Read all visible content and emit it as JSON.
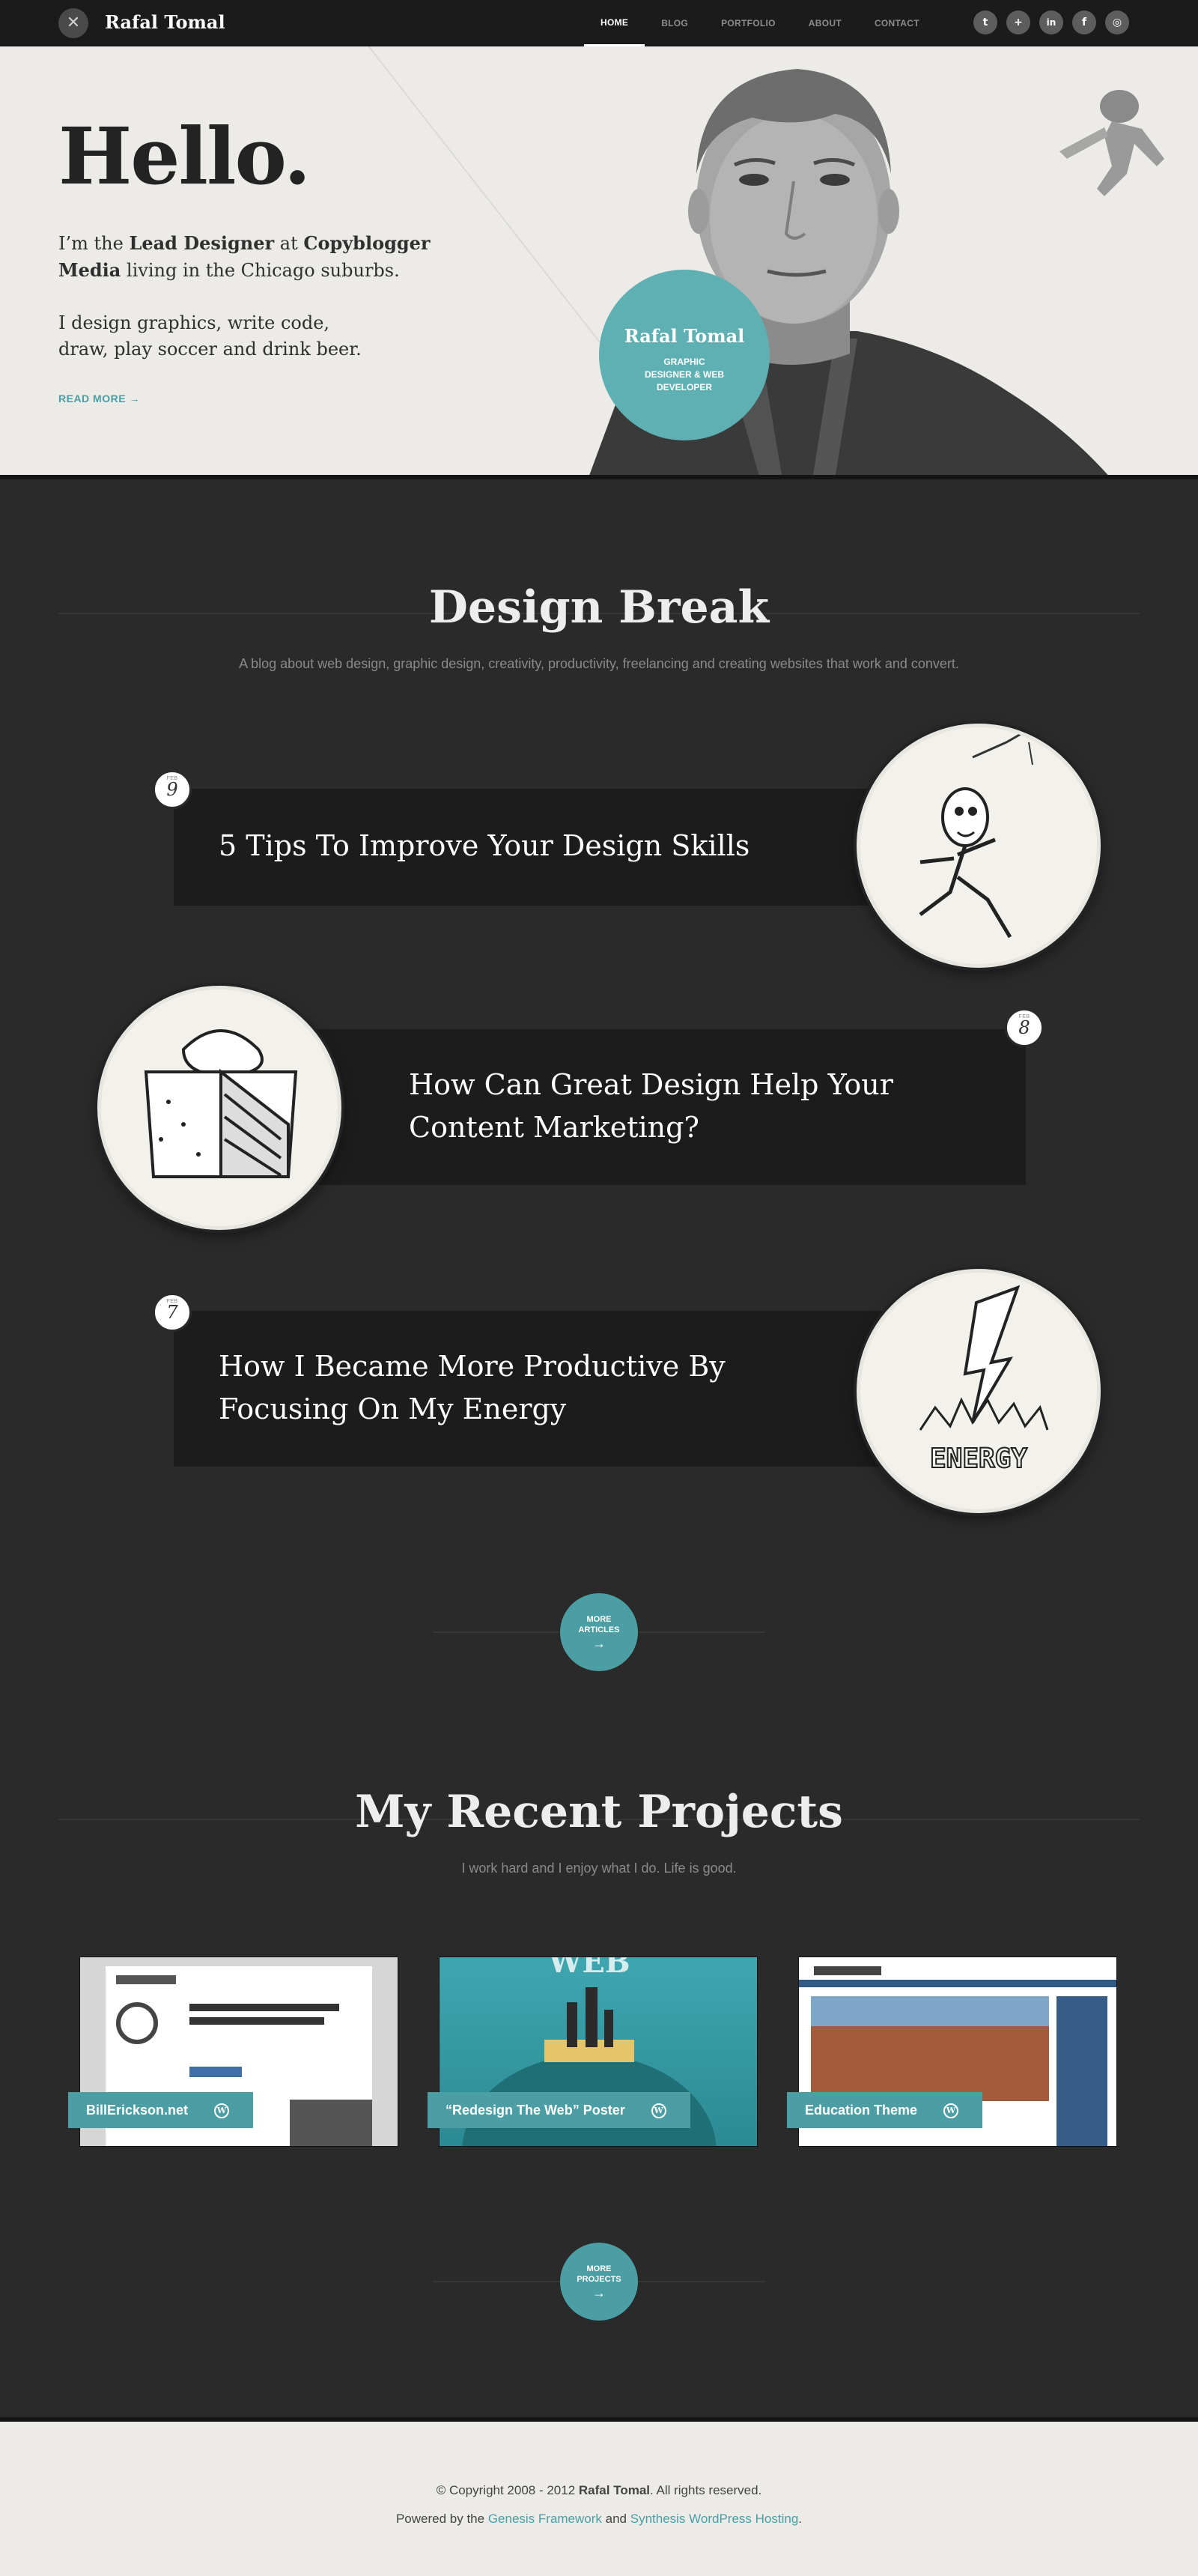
{
  "site": {
    "brand": "Rafal Tomal"
  },
  "nav": [
    {
      "label": "HOME",
      "active": true
    },
    {
      "label": "BLOG"
    },
    {
      "label": "PORTFOLIO"
    },
    {
      "label": "ABOUT"
    },
    {
      "label": "CONTACT"
    }
  ],
  "social": [
    {
      "name": "twitter-icon",
      "glyph": "t"
    },
    {
      "name": "google-plus-icon",
      "glyph": "+"
    },
    {
      "name": "linkedin-icon",
      "glyph": "in"
    },
    {
      "name": "facebook-icon",
      "glyph": "f"
    },
    {
      "name": "dribbble-icon",
      "glyph": "◎"
    }
  ],
  "hero": {
    "heading": "Hello.",
    "intro_pre": "I’m the ",
    "intro_role": "Lead Designer",
    "intro_mid": " at ",
    "intro_company": "Copyblogger Media",
    "intro_post": " living in the Chicago suburbs.",
    "intro2": "I design graphics, write code, draw, play soccer and drink beer.",
    "read_more": "READ MORE →",
    "badge_name": "Rafal Tomal",
    "badge_title": "GRAPHIC DESIGNER & WEB DEVELOPER"
  },
  "blog": {
    "title": "Design Break",
    "subtitle": "A blog about web design, graphic design, creativity, productivity, freelancing and creating websites that work and convert.",
    "articles": [
      {
        "title": "5 Tips To Improve Your Design Skills",
        "month": "FEB",
        "day": "9",
        "illustration": "running-man-illustration"
      },
      {
        "title": "How Can Great Design Help Your Content Marketing?",
        "month": "FEB",
        "day": "8",
        "illustration": "cake-illustration"
      },
      {
        "title": "How I Became More Productive By Focusing On My Energy",
        "month": "FEB",
        "day": "7",
        "illustration": "energy-illustration",
        "illustration_text": "ENERGY"
      }
    ],
    "more_label": "MORE ARTICLES",
    "more_arrow": "→"
  },
  "projects": {
    "title": "My Recent Projects",
    "subtitle": "I work hard and I enjoy what I do. Life is good.",
    "items": [
      {
        "caption": "BillErickson.net"
      },
      {
        "caption": "“Redesign The Web” Poster"
      },
      {
        "caption": "Education Theme"
      }
    ],
    "more_label": "MORE PROJECTS",
    "more_arrow": "→",
    "wp_glyph": "W"
  },
  "footer": {
    "copy_pre": "© Copyright 2008 - 2012 ",
    "copy_name": "Rafal Tomal",
    "copy_post": ". All rights reserved.",
    "powered_pre": "Powered by the ",
    "framework": "Genesis Framework",
    "powered_mid": " and ",
    "hosting": "Synthesis WordPress Hosting",
    "powered_post": "."
  },
  "colors": {
    "accent": "#4a9ea4",
    "badge": "#5fb0b3",
    "dark_bg": "#2a2a2a",
    "panel": "#1c1c1c",
    "light_bg": "#ecebe7"
  }
}
